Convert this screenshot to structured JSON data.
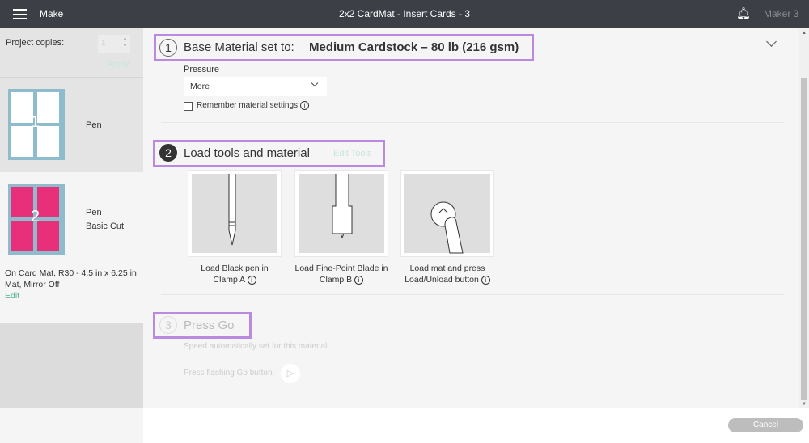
{
  "header": {
    "menu_label": "Make",
    "title": "2x2 CardMat - Insert Cards - 3",
    "device": "Maker 3"
  },
  "sidebar": {
    "copies_label": "Project copies:",
    "copies_value": "1",
    "apply_label": "Apply",
    "mats": [
      {
        "number": "1",
        "tools": [
          "Pen"
        ]
      },
      {
        "number": "2",
        "tools": [
          "Pen",
          "Basic Cut"
        ]
      }
    ],
    "mat_info": "On Card Mat, R30 - 4.5 in x 6.25 in Mat, Mirror Off",
    "edit_label": "Edit"
  },
  "step1": {
    "number": "1",
    "label": "Base Material set to:",
    "material": "Medium Cardstock – 80 lb (216 gsm)",
    "pressure_label": "Pressure",
    "pressure_value": "More",
    "remember_label": "Remember material settings"
  },
  "step2": {
    "number": "2",
    "label": "Load tools and material",
    "edit_tools": "Edit Tools",
    "tiles": [
      {
        "line1": "Load Black pen in",
        "line2": "Clamp A"
      },
      {
        "line1": "Load Fine-Point Blade in",
        "line2": "Clamp B"
      },
      {
        "line1": "Load mat and press",
        "line2": "Load/Unload button"
      }
    ]
  },
  "step3": {
    "number": "3",
    "label": "Press Go",
    "speed_text": "Speed automatically set for this material.",
    "press_text": "Press flashing Go button."
  },
  "footer": {
    "cancel_label": "Cancel"
  },
  "colors": {
    "header": "#3d3f46",
    "highlight": "#b98ae0",
    "accent": "#4bb38a",
    "mat": "#8fbccc",
    "card_pink": "#e8307a"
  }
}
